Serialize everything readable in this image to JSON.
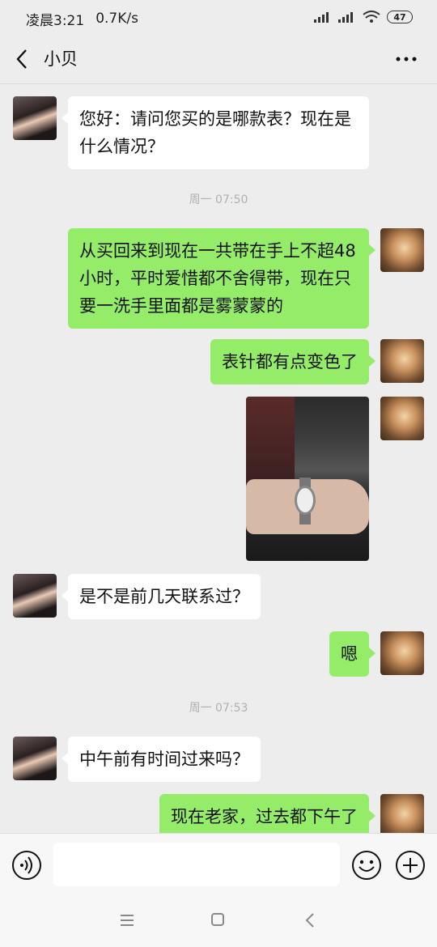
{
  "status_bar": {
    "time": "凌晨3:21",
    "net_speed": "0.7K/s",
    "battery": "47"
  },
  "header": {
    "title": "小贝"
  },
  "messages": [
    {
      "side": "left",
      "text": "您好：请问您买的是哪款表？现在是什么情况？"
    },
    {
      "side": "time",
      "text": "周一 07:50"
    },
    {
      "side": "right",
      "text": "从买回来到现在一共带在手上不超48 小时，平时爱惜都不舍得带，现在只要一洗手里面都是雾蒙蒙的"
    },
    {
      "side": "right",
      "text": "表针都有点变色了"
    },
    {
      "side": "right",
      "type": "image"
    },
    {
      "side": "left",
      "text": "是不是前几天联系过？"
    },
    {
      "side": "right",
      "text": "嗯"
    },
    {
      "side": "time",
      "text": "周一 07:53"
    },
    {
      "side": "left",
      "text": "中午前有时间过来吗？"
    },
    {
      "side": "right",
      "text": "现在老家，过去都下午了"
    }
  ],
  "input": {
    "value": "",
    "placeholder": ""
  },
  "icons": {
    "back": "back-arrow-icon",
    "more": "more-dots-icon",
    "voice": "voice-icon",
    "emoji": "emoji-icon",
    "plus": "plus-icon"
  }
}
